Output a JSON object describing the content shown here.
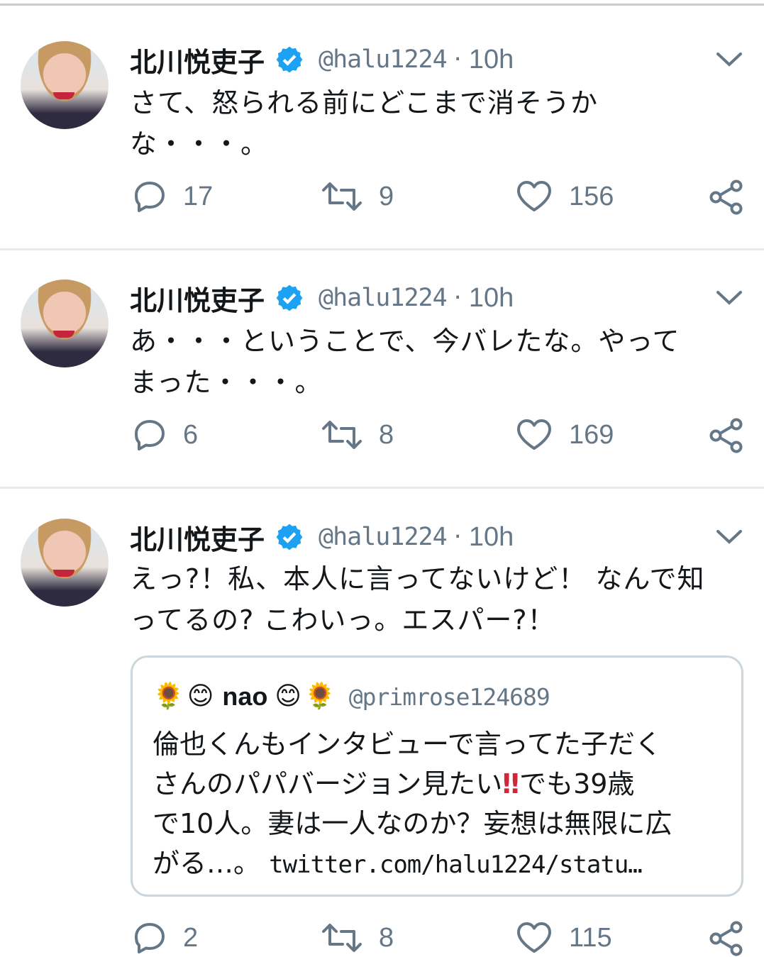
{
  "tweets": [
    {
      "author": {
        "name": "北川悦吏子",
        "handle": "@halu1224",
        "time": "10h"
      },
      "text": "さて、怒られる前にどこまで消そうか\nな・・・。",
      "replies": "17",
      "retweets": "9",
      "likes": "156"
    },
    {
      "author": {
        "name": "北川悦吏子",
        "handle": "@halu1224",
        "time": "10h"
      },
      "text": "あ・・・ということで、今バレたな。やって\nまった・・・。",
      "replies": "6",
      "retweets": "8",
      "likes": "169"
    },
    {
      "author": {
        "name": "北川悦吏子",
        "handle": "@halu1224",
        "time": "10h"
      },
      "text": "えっ?！私、本人に言ってないけど！ なんで知\nってるの? こわいっ。エスパー?！",
      "replies": "2",
      "retweets": "8",
      "likes": "115",
      "quote": {
        "emoji_sunflower": "🌻",
        "emoji_smile": "😊",
        "name": "nao",
        "handle": "@primrose124689",
        "text_part1": "倫也くんもインタビューで言ってた子だく\nさんのパパバージョン見たい",
        "text_bang": "‼",
        "text_part2": "でも39歳\nで10人。妻は一人なのか？妄想は無限に広\nがる…。 ",
        "link": "twitter.com/halu1224/statu…"
      }
    }
  ],
  "colors": {
    "secondary": "#657786",
    "verified": "#1da1f2",
    "divider": "#e6ecf0"
  },
  "icons": [
    "verified-badge-icon",
    "chevron-down-icon",
    "reply-icon",
    "retweet-icon",
    "like-icon",
    "share-icon"
  ]
}
